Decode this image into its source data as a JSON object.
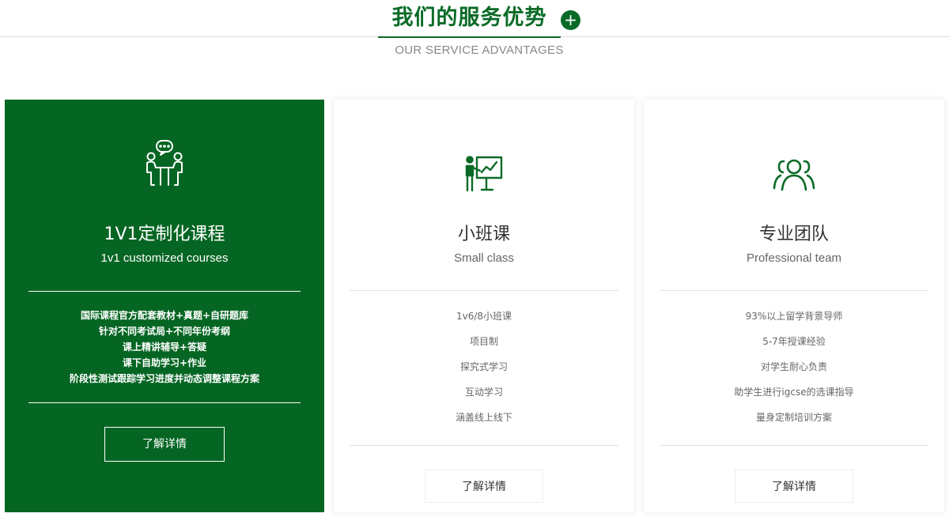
{
  "header": {
    "title": "我们的服务优势",
    "plus": "+",
    "subtitle": "OUR SERVICE ADVANTAGES"
  },
  "colors": {
    "brand_green": "#0a6b27",
    "active_card": "#056623"
  },
  "cards": [
    {
      "icon": "tutoring-discussion-icon",
      "title": "1V1定制化课程",
      "subtitle": "1v1 customized courses",
      "features": [
        "国际课程官方配套教材+真题+自研题库",
        "针对不同考试局+不同年份考纲",
        "课上精讲辅导+答疑",
        "课下自助学习+作业",
        "阶段性测试跟踪学习进度并动态调整课程方案"
      ],
      "button": "了解详情",
      "active": true
    },
    {
      "icon": "teacher-presentation-icon",
      "title": "小班课",
      "subtitle": "Small class",
      "features": [
        "1v6/8小班课",
        "项目制",
        "探究式学习",
        "互动学习",
        "涵盖线上线下"
      ],
      "button": "了解详情",
      "active": false
    },
    {
      "icon": "team-group-icon",
      "title": "专业团队",
      "subtitle": "Professional team",
      "features": [
        "93%以上留学背景导师",
        "5-7年授课经验",
        "对学生耐心负责",
        "助学生进行igcse的选课指导",
        "量身定制培训方案"
      ],
      "button": "了解详情",
      "active": false
    }
  ]
}
